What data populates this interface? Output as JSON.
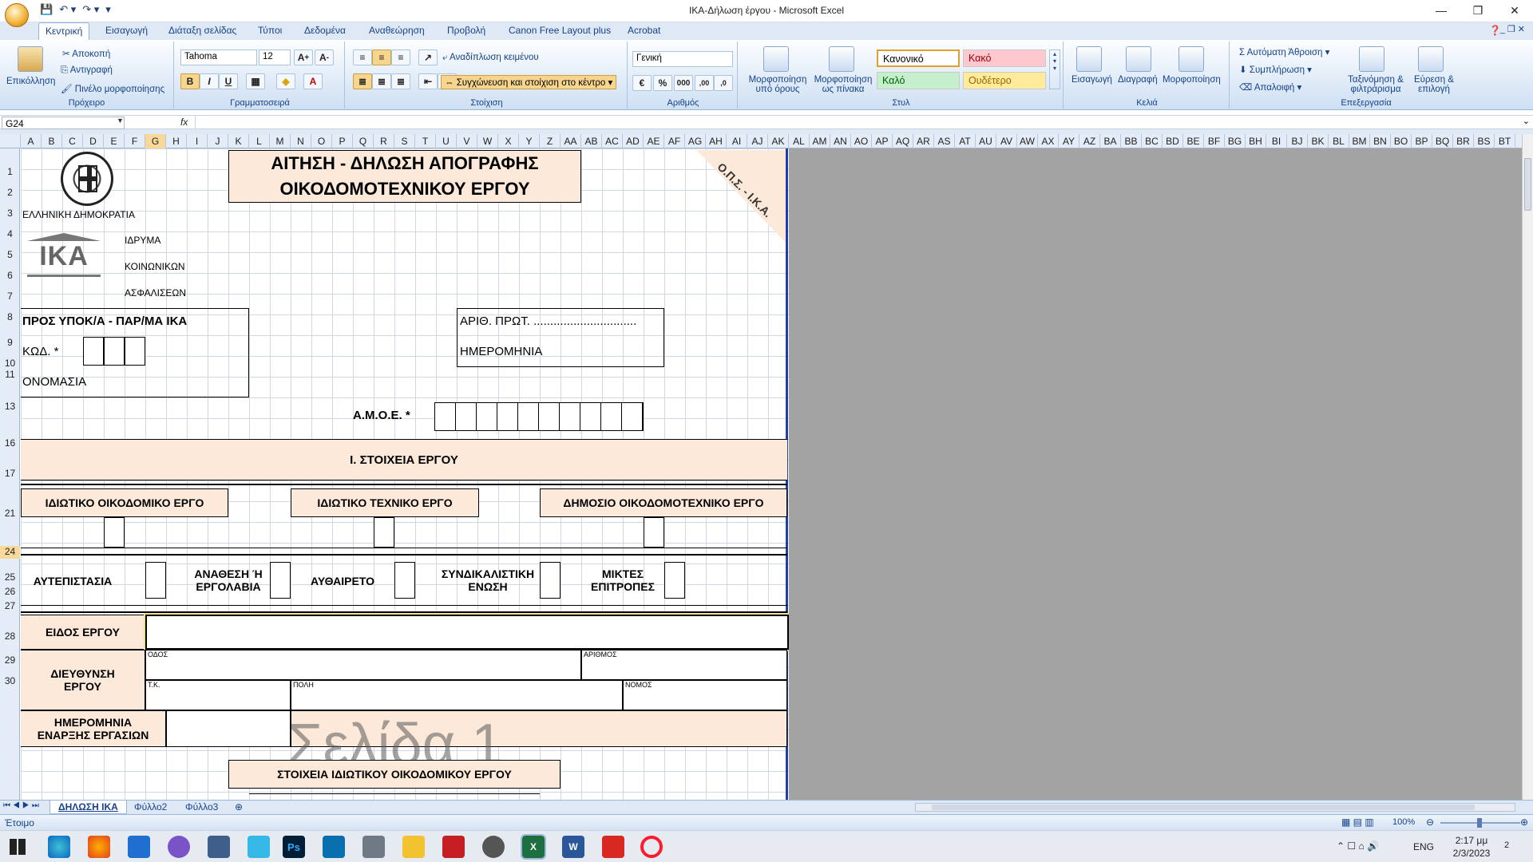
{
  "window": {
    "title": "ΙΚΑ-Δήλωση έργου - Microsoft Excel"
  },
  "tabs": [
    "Κεντρική",
    "Εισαγωγή",
    "Διάταξη σελίδας",
    "Τύποι",
    "Δεδομένα",
    "Αναθεώρηση",
    "Προβολή",
    "Canon Free Layout plus",
    "Acrobat"
  ],
  "ribbon": {
    "clipboard": {
      "label": "Πρόχειρο",
      "paste": "Επικόλληση",
      "cut": "Αποκοπή",
      "copy": "Αντιγραφή",
      "painter": "Πινέλο μορφοποίησης"
    },
    "font": {
      "label": "Γραμματοσειρά",
      "name": "Tahoma",
      "size": "12"
    },
    "alignment": {
      "label": "Στοίχιση",
      "wrap": "Αναδίπλωση κειμένου",
      "merge": "Συγχώνευση και στοίχιση στο κέντρο"
    },
    "number": {
      "label": "Αριθμός",
      "format": "Γενική"
    },
    "styles": {
      "label": "Στυλ",
      "cond_line1": "Μορφοποίηση",
      "cond_line2": "υπό όρους",
      "table_line1": "Μορφοποίηση",
      "table_line2": "ως πίνακα",
      "normal": "Κανονικό",
      "bad": "Κακό",
      "good": "Καλό",
      "neutral": "Ουδέτερο"
    },
    "cells": {
      "label": "Κελιά",
      "insert": "Εισαγωγή",
      "delete": "Διαγραφή",
      "format": "Μορφοποίηση"
    },
    "editing": {
      "label": "Επεξεργασία",
      "autosum": "Αυτόματη Άθροιση",
      "fill": "Συμπλήρωση",
      "clear": "Απαλοιφή",
      "sort_line1": "Ταξινόμηση &",
      "sort_line2": "φιλτράρισμα",
      "find_line1": "Εύρεση &",
      "find_line2": "επιλογή"
    }
  },
  "formula_bar": {
    "name_box": "G24",
    "fx": "fx",
    "content": ""
  },
  "columns": [
    "A",
    "B",
    "C",
    "D",
    "E",
    "F",
    "G",
    "H",
    "I",
    "J",
    "K",
    "L",
    "M",
    "N",
    "O",
    "P",
    "Q",
    "R",
    "S",
    "T",
    "U",
    "V",
    "W",
    "X",
    "Y",
    "Z",
    "AA",
    "AB",
    "AC",
    "AD",
    "AE",
    "AF",
    "AG",
    "AH",
    "AI",
    "AJ",
    "AK",
    "AL",
    "AM",
    "AN",
    "AO",
    "AP",
    "AQ",
    "AR",
    "AS",
    "AT",
    "AU",
    "AV",
    "AW",
    "AX",
    "AY",
    "AZ",
    "BA",
    "BB",
    "BC",
    "BD",
    "BE",
    "BF",
    "BG",
    "BH",
    "BI",
    "BJ",
    "BK",
    "BL",
    "BM",
    "BN",
    "BO",
    "BP",
    "BQ",
    "BR",
    "BS",
    "BT"
  ],
  "rows": [
    "1",
    "2",
    "3",
    "4",
    "5",
    "6",
    "7",
    "8",
    "9",
    "10",
    "11",
    "13",
    "16",
    "17",
    "21",
    "24",
    "25",
    "26",
    "27",
    "28",
    "29",
    "30"
  ],
  "sheet": {
    "title_line1": "ΑΙΤΗΣΗ - ΔΗΛΩΣΗ ΑΠΟΓΡΑΦΗΣ",
    "title_line2": "ΟΙΚΟΔΟΜΟΤΕΧΝΙΚΟΥ ΕΡΓΟΥ",
    "corner": "Ο.Π.Σ. - Ι.Κ.Α.",
    "republic": "ΕΛΛΗΝΙΚΗ ΔΗΜΟΚΡΑΤΙΑ",
    "logo": "ΙΚΑ",
    "ika_line1": "ΙΔΡΥΜΑ",
    "ika_line2": "ΚΟΙΝΩΝΙΚΩΝ",
    "ika_line3": "ΑΣΦΑΛΙΣΕΩΝ",
    "to": "ΠΡΟΣ ΥΠΟΚ/Α - ΠΑΡ/ΜΑ ΙΚΑ",
    "code": "ΚΩΔ. *",
    "name": "ΟΝΟΜΑΣΙΑ",
    "prot": "ΑΡΙΘ. ΠΡΩΤ. ...............................",
    "date": "ΗΜΕΡΟΜΗΝΙΑ",
    "amoe": "Α.Μ.Ο.Ε. *",
    "section1": "Ι. ΣΤΟΙΧΕΙΑ ΕΡΓΟΥ",
    "type_private_building": "ΙΔΙΩΤΙΚΟ ΟΙΚΟΔΟΜΙΚΟ ΕΡΓΟ",
    "type_private_tech": "ΙΔΙΩΤΙΚΟ ΤΕΧΝΙΚΟ ΕΡΓΟ",
    "type_public": "ΔΗΜΟΣΙΟ ΟΙΚΟΔΟΜΟΤΕΧΝΙΚΟ ΕΡΓΟ",
    "opt1": "ΑΥΤΕΠΙΣΤΑΣΙΑ",
    "opt2_line1": "ΑΝΑΘΕΣΗ Ή",
    "opt2_line2": "ΕΡΓΟΛΑΒΙΑ",
    "opt3": "ΑΥΘΑΙΡΕΤΟ",
    "opt4_line1": "ΣΥΝΔΙΚΑΛΙΣΤΙΚΗ",
    "opt4_line2": "ΕΝΩΣΗ",
    "opt5_line1": "ΜΙΚΤΕΣ",
    "opt5_line2": "ΕΠΙΤΡΟΠΕΣ",
    "kind": "ΕΙΔΟΣ ΕΡΓΟΥ",
    "address_line1": "ΔΙΕΥΘΥΝΣΗ",
    "address_line2": "ΕΡΓΟΥ",
    "street": "ΟΔΟΣ",
    "number": "ΑΡΙΘΜΟΣ",
    "tk": "Τ.Κ.",
    "city": "ΠΟΛΗ",
    "prefecture": "ΝΟΜΟΣ",
    "start_line1": "ΗΜΕΡΟΜΗΝΙΑ",
    "start_line2": "ΕΝΑΡΞΗΣ ΕΡΓΑΣΙΩΝ",
    "watermark": "Σελίδα 1",
    "section_private": "ΣΤΟΙΧΕΙΑ ΙΔΙΩΤΙΚΟΥ ΟΙΚΟΔΟΜΙΚΟΥ ΕΡΓΟΥ"
  },
  "sheet_tabs": [
    "ΔΗΛΩΣΗ ΙΚΑ",
    "Φύλλο2",
    "Φύλλο3"
  ],
  "status": {
    "ready": "Έτοιμο",
    "zoom": "100%"
  },
  "taskbar": {
    "lang": "ENG",
    "time": "2:17 μμ",
    "date": "2/3/2023",
    "notifications": "2"
  }
}
